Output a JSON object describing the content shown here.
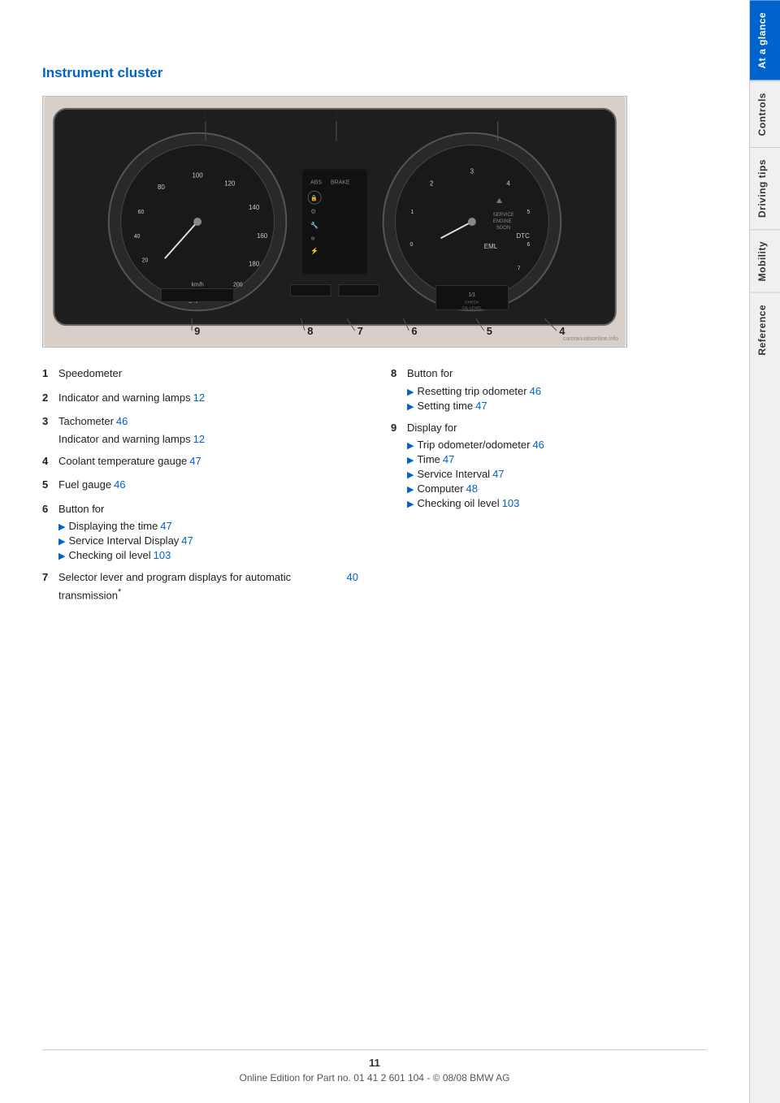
{
  "page": {
    "title": "Instrument cluster",
    "number": "11",
    "footer_text": "Online Edition for Part no. 01 41 2 601 104 - © 08/08 BMW AG"
  },
  "sidebar": {
    "tabs": [
      {
        "id": "at-a-glance",
        "label": "At a glance",
        "active": true
      },
      {
        "id": "controls",
        "label": "Controls",
        "active": false
      },
      {
        "id": "driving-tips",
        "label": "Driving tips",
        "active": false
      },
      {
        "id": "mobility",
        "label": "Mobility",
        "active": false
      },
      {
        "id": "reference",
        "label": "Reference",
        "active": false
      }
    ]
  },
  "items_left": [
    {
      "number": "1",
      "text": "Speedometer",
      "link": null,
      "sub_items": []
    },
    {
      "number": "2",
      "text": "Indicator and warning lamps",
      "link": "12",
      "sub_items": []
    },
    {
      "number": "3",
      "text": "Tachometer",
      "link": "46",
      "sub_items": [
        {
          "text": "Indicator and warning lamps",
          "link": "12"
        }
      ]
    },
    {
      "number": "4",
      "text": "Coolant temperature gauge",
      "link": "47",
      "sub_items": []
    },
    {
      "number": "5",
      "text": "Fuel gauge",
      "link": "46",
      "sub_items": []
    },
    {
      "number": "6",
      "text": "Button for",
      "link": null,
      "sub_items": [
        {
          "text": "Displaying the time",
          "link": "47"
        },
        {
          "text": "Service Interval Display",
          "link": "47"
        },
        {
          "text": "Checking oil level",
          "link": "103"
        }
      ]
    },
    {
      "number": "7",
      "text": "Selector lever and program displays for automatic transmission",
      "link": "40",
      "asterisk": true,
      "sub_items": []
    }
  ],
  "items_right": [
    {
      "number": "8",
      "text": "Button for",
      "link": null,
      "sub_items": [
        {
          "text": "Resetting trip odometer",
          "link": "46"
        },
        {
          "text": "Setting time",
          "link": "47"
        }
      ]
    },
    {
      "number": "9",
      "text": "Display for",
      "link": null,
      "sub_items": [
        {
          "text": "Trip odometer/odometer",
          "link": "46"
        },
        {
          "text": "Time",
          "link": "47"
        },
        {
          "text": "Service Interval",
          "link": "47"
        },
        {
          "text": "Computer",
          "link": "48"
        },
        {
          "text": "Checking oil level",
          "link": "103"
        }
      ]
    }
  ],
  "cluster_numbers": [
    {
      "id": "1",
      "x": "200",
      "y": "138"
    },
    {
      "id": "2",
      "x": "360",
      "y": "138"
    },
    {
      "id": "3",
      "x": "560",
      "y": "138"
    },
    {
      "id": "9",
      "x": "180",
      "y": "320"
    },
    {
      "id": "8",
      "x": "320",
      "y": "320"
    },
    {
      "id": "7",
      "x": "380",
      "y": "320"
    },
    {
      "id": "6",
      "x": "445",
      "y": "320"
    },
    {
      "id": "5",
      "x": "530",
      "y": "320"
    },
    {
      "id": "4",
      "x": "620",
      "y": "320"
    }
  ]
}
